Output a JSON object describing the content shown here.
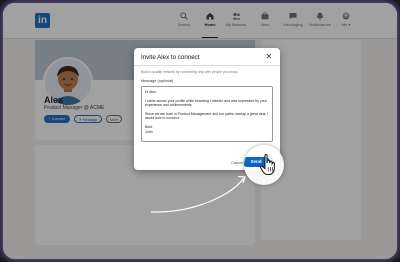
{
  "nav": {
    "logo": "in",
    "items": [
      {
        "label": "Search",
        "icon": "search-icon"
      },
      {
        "label": "Home",
        "icon": "home-icon"
      },
      {
        "label": "My Network",
        "icon": "network-icon"
      },
      {
        "label": "Jobs",
        "icon": "briefcase-icon"
      },
      {
        "label": "Messaging",
        "icon": "message-icon"
      },
      {
        "label": "Notifications",
        "icon": "bell-icon"
      },
      {
        "label": "Me ▾",
        "icon": "avatar-icon"
      }
    ]
  },
  "profile": {
    "name": "Alex",
    "title": "Product Manager @ ACME",
    "buttons": {
      "connect": "+ Connect",
      "message": "✈ Message",
      "more": "More"
    }
  },
  "dialog": {
    "title": "Invite Alex to connect",
    "close_symbol": "✕",
    "subtitle": "Build a quality network by connecting only with people you know.",
    "message_label": "Message (optional)",
    "message": "Hi Alex,\n\nI came across your profile while browsing LinkedIn and was impressed by your experience and achievements.\n\nSince we are both in Product Management and our paths overlap a great deal, I would love to connect.\n\nBest,\nJohn",
    "cancel_label": "Cancel",
    "send_label": "Send"
  },
  "colors": {
    "brand": "#0a66c2",
    "glow": "#8c6ee6"
  }
}
